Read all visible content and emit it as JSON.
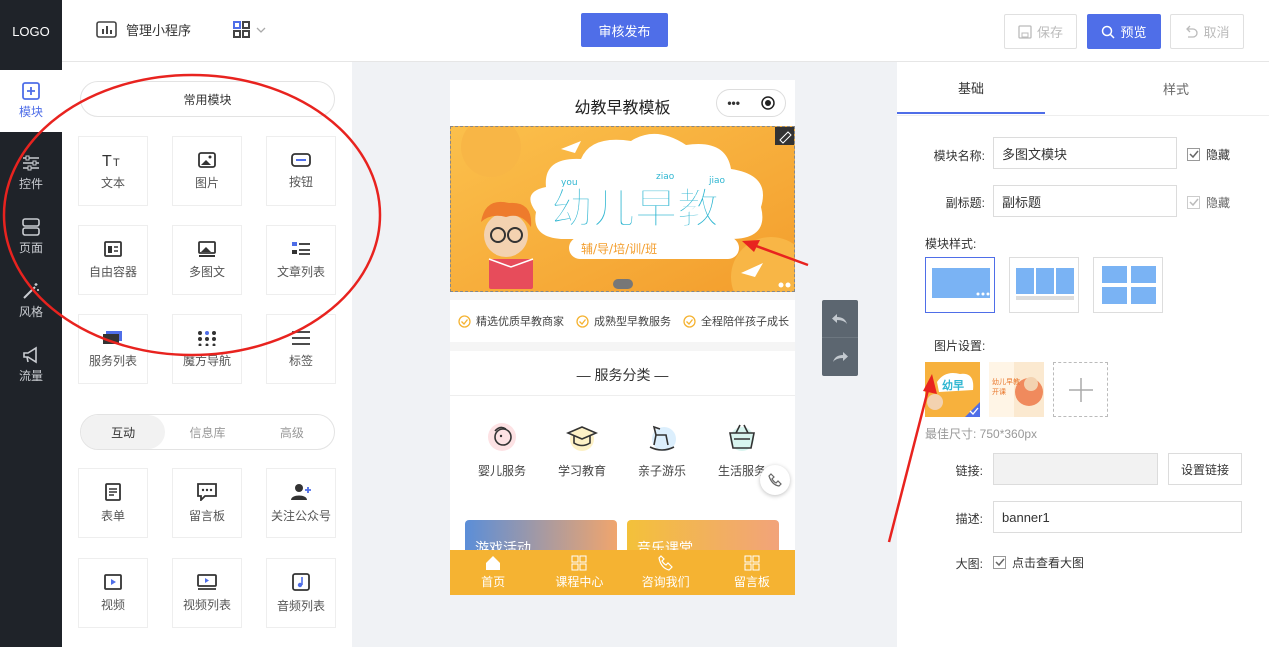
{
  "topbar": {
    "logo": "LOGO",
    "manage": "管理小程序",
    "publish": "审核发布",
    "save": "保存",
    "preview": "预览",
    "cancel": "取消"
  },
  "rail": [
    {
      "label": "模块",
      "icon": "plus-square-icon"
    },
    {
      "label": "控件",
      "icon": "sliders-icon"
    },
    {
      "label": "页面",
      "icon": "server-icon"
    },
    {
      "label": "风格",
      "icon": "magic-wand-icon"
    },
    {
      "label": "流量",
      "icon": "megaphone-icon"
    }
  ],
  "panel": {
    "common_title": "常用模块",
    "common": [
      {
        "label": "文本",
        "icon": "text-icon"
      },
      {
        "label": "图片",
        "icon": "image-icon"
      },
      {
        "label": "按钮",
        "icon": "button-icon"
      },
      {
        "label": "自由容器",
        "icon": "container-icon"
      },
      {
        "label": "多图文",
        "icon": "multi-image-icon"
      },
      {
        "label": "文章列表",
        "icon": "article-list-icon"
      },
      {
        "label": "服务列表",
        "icon": "service-list-icon"
      },
      {
        "label": "魔方导航",
        "icon": "grid-nav-icon"
      },
      {
        "label": "标签",
        "icon": "tag-icon"
      }
    ],
    "tabs": [
      "互动",
      "信息库",
      "高级"
    ],
    "interact": [
      {
        "label": "表单",
        "icon": "form-icon"
      },
      {
        "label": "留言板",
        "icon": "message-board-icon"
      },
      {
        "label": "关注公众号",
        "icon": "follow-user-icon"
      },
      {
        "label": "视频",
        "icon": "video-icon"
      },
      {
        "label": "视频列表",
        "icon": "video-list-icon"
      },
      {
        "label": "音频列表",
        "icon": "audio-list-icon"
      }
    ]
  },
  "phone": {
    "title": "幼教早教模板",
    "banner_main": "幼儿早教",
    "banner_sub": "辅/导/培/训/班",
    "banner_words": [
      "you",
      "ziao",
      "jiao"
    ],
    "features": [
      "精选优质早教商家",
      "成熟型早教服务",
      "全程陪伴孩子成长"
    ],
    "service_title": "服务分类",
    "services": [
      {
        "label": "婴儿服务",
        "icon": "baby-icon"
      },
      {
        "label": "学习教育",
        "icon": "graduation-cap-icon"
      },
      {
        "label": "亲子游乐",
        "icon": "rocking-horse-icon"
      },
      {
        "label": "生活服务",
        "icon": "basket-icon"
      }
    ],
    "cards": [
      "游戏活动",
      "音乐课堂"
    ],
    "tabbar": [
      {
        "label": "首页",
        "icon": "home-icon"
      },
      {
        "label": "课程中心",
        "icon": "grid-icon"
      },
      {
        "label": "咨询我们",
        "icon": "phone-icon"
      },
      {
        "label": "留言板",
        "icon": "grid-icon"
      }
    ]
  },
  "settings": {
    "tabs": [
      "基础",
      "样式"
    ],
    "name_label": "模块名称:",
    "name_value": "多图文模块",
    "hide_label": "隐藏",
    "subtitle_label": "副标题:",
    "subtitle_value": "副标题",
    "style_label": "模块样式:",
    "image_label": "图片设置:",
    "size_hint": "最佳尺寸: 750*360px",
    "link_label": "链接:",
    "link_button": "设置链接",
    "desc_label": "描述:",
    "desc_value": "banner1",
    "bigimg_label": "大图:",
    "bigimg_check": "点击查看大图"
  },
  "colors": {
    "accent": "#4f6ee8",
    "rail": "#1f2329",
    "annotation": "#e8231f",
    "tabbar": "#f5b332"
  }
}
